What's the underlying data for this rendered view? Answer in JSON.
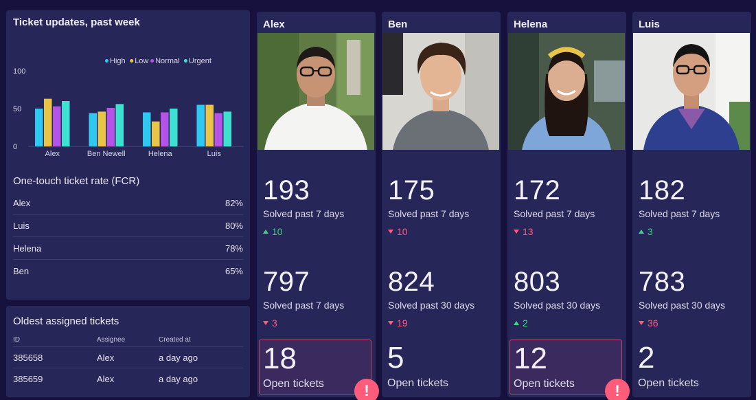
{
  "colors": {
    "high": "#2ec8f0",
    "low": "#e8c547",
    "normal": "#b454e6",
    "urgent": "#3ee0d0",
    "up": "#39d683",
    "down": "#ff5c7c"
  },
  "chart_data": {
    "type": "bar",
    "title": "Ticket updates, past week",
    "categories": [
      "Alex",
      "Ben Newell",
      "Helena",
      "Luis"
    ],
    "series": [
      {
        "name": "High",
        "values": [
          50,
          44,
          45,
          55
        ]
      },
      {
        "name": "Low",
        "values": [
          63,
          46,
          33,
          55
        ]
      },
      {
        "name": "Normal",
        "values": [
          53,
          51,
          45,
          44
        ]
      },
      {
        "name": "Urgent",
        "values": [
          60,
          56,
          50,
          46
        ]
      }
    ],
    "yticks": [
      "0",
      "50",
      "100"
    ],
    "ylim": [
      0,
      110
    ],
    "legend_position": "top-right",
    "grid": false
  },
  "fcr": {
    "title": "One-touch ticket rate (FCR)",
    "rows": [
      {
        "name": "Alex",
        "value": "82%"
      },
      {
        "name": "Luis",
        "value": "80%"
      },
      {
        "name": "Helena",
        "value": "78%"
      },
      {
        "name": "Ben",
        "value": "65%"
      }
    ]
  },
  "oldest": {
    "title": "Oldest assigned tickets",
    "headers": {
      "id": "ID",
      "assignee": "Assignee",
      "created": "Created at"
    },
    "rows": [
      {
        "id": "385658",
        "assignee": "Alex",
        "created": "a day ago"
      },
      {
        "id": "385659",
        "assignee": "Alex",
        "created": "a day ago"
      }
    ]
  },
  "agents": [
    {
      "name": "Alex",
      "m1": {
        "value": "193",
        "label": "Solved past 7 days",
        "delta": "10",
        "dir": "up"
      },
      "m2": {
        "value": "797",
        "label": "Solved past 7 days",
        "delta": "3",
        "dir": "down"
      },
      "open": {
        "value": "18",
        "label": "Open tickets",
        "alert": "!"
      }
    },
    {
      "name": "Ben",
      "m1": {
        "value": "175",
        "label": "Solved past 7 days",
        "delta": "10",
        "dir": "down"
      },
      "m2": {
        "value": "824",
        "label": "Solved past 30 days",
        "delta": "19",
        "dir": "down"
      },
      "open": {
        "value": "5",
        "label": "Open tickets"
      }
    },
    {
      "name": "Helena",
      "m1": {
        "value": "172",
        "label": "Solved past 7 days",
        "delta": "13",
        "dir": "down"
      },
      "m2": {
        "value": "803",
        "label": "Solved past 30 days",
        "delta": "2",
        "dir": "up"
      },
      "open": {
        "value": "12",
        "label": "Open tickets",
        "alert": "!"
      }
    },
    {
      "name": "Luis",
      "m1": {
        "value": "182",
        "label": "Solved past 7 days",
        "delta": "3",
        "dir": "up"
      },
      "m2": {
        "value": "783",
        "label": "Solved past 30 days",
        "delta": "36",
        "dir": "down"
      },
      "open": {
        "value": "2",
        "label": "Open tickets"
      }
    }
  ]
}
